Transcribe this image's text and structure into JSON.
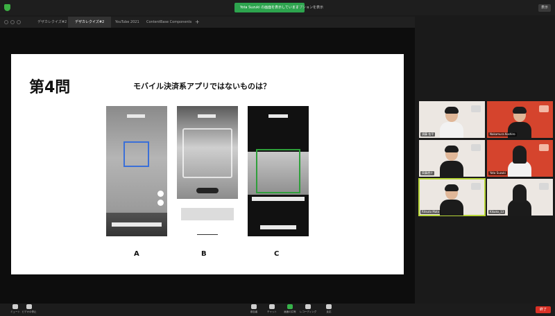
{
  "top": {
    "share_banner": "Yota Suzuki の画面を表示しています",
    "view_options": "オプションを表示",
    "view_button": "表示"
  },
  "browser_tabs": [
    {
      "label": "デザカレクイズ#2"
    },
    {
      "label": "デザカレクイズ#2",
      "active": true
    },
    {
      "label": "YouTube 2021"
    },
    {
      "label": "ContentBase Components"
    }
  ],
  "slide": {
    "number": "第4問",
    "question": "モバイル決済系アプリではないものは？",
    "options": [
      "A",
      "B",
      "C"
    ]
  },
  "participants": [
    {
      "name": "須藤 佑平",
      "bg": "white"
    },
    {
      "name": "Nakamura Koshiro",
      "bg": "red"
    },
    {
      "name": "齊藤遼介",
      "bg": "white"
    },
    {
      "name": "Yota Suzuki",
      "bg": "red"
    },
    {
      "name": "Ritsuto Mato",
      "bg": "white",
      "active": true
    },
    {
      "name": "Kikuko_13",
      "bg": "white"
    }
  ],
  "controls": {
    "mute": "ミュート",
    "video": "ビデオの停止",
    "participants": "参加者",
    "participants_count": "6",
    "chat": "チャット",
    "share": "画面の共有",
    "record": "レコーディング",
    "reactions": "反応",
    "end": "終了"
  },
  "colors": {
    "share_green": "#2da44e",
    "end_red": "#d93025",
    "active_speaker": "#b8d638",
    "scan_blue": "#3a6fd8",
    "scan_green": "#2e9f3a"
  }
}
